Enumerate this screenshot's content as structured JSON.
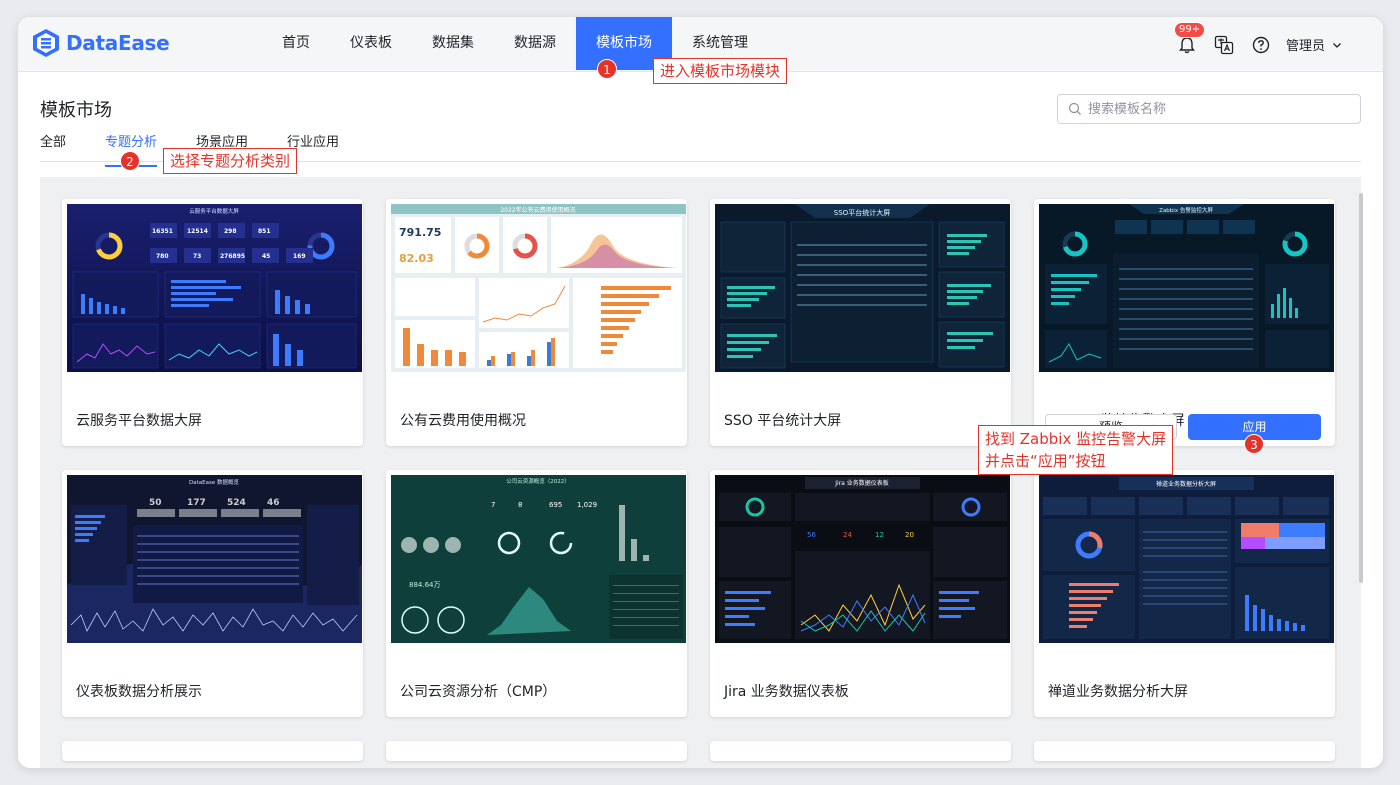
{
  "app": {
    "logo_text": "DataEase"
  },
  "nav": [
    {
      "label": "首页"
    },
    {
      "label": "仪表板"
    },
    {
      "label": "数据集"
    },
    {
      "label": "数据源"
    },
    {
      "label": "模板市场",
      "active": true
    },
    {
      "label": "系统管理"
    }
  ],
  "header": {
    "badge": "99+",
    "user": "管理员"
  },
  "page": {
    "title": "模板市场",
    "search_placeholder": "搜索模板名称"
  },
  "tabs": [
    {
      "label": "全部"
    },
    {
      "label": "专题分析",
      "active": true
    },
    {
      "label": "场景应用"
    },
    {
      "label": "行业应用"
    }
  ],
  "cards": [
    {
      "name": "云服务平台数据大屏",
      "thumb_title": "云服务平台数据大屏"
    },
    {
      "name": "公有云费用使用概况",
      "thumb_title": "2022年公有云费用使用概况"
    },
    {
      "name": "SSO 平台统计大屏",
      "thumb_title": "SSO平台统计大屏"
    },
    {
      "name": "Zabbix 监控告警大屏",
      "thumb_title": "Zabbix 告警监控大屏"
    },
    {
      "name": "仪表板数据分析展示",
      "thumb_title": "DataEase 数据概览"
    },
    {
      "name": "公司云资源分析（CMP）",
      "thumb_title": "公司云资源概览（2022）"
    },
    {
      "name": "Jira 业务数据仪表板",
      "thumb_title": "Jira 业务数据仪表板"
    },
    {
      "name": "禅道业务数据分析大屏",
      "thumb_title": "禅道业务数据分析大屏"
    }
  ],
  "thumb_numbers": {
    "c1": [
      "16351",
      "12514",
      "298",
      "851",
      "780",
      "73",
      "276895",
      "45",
      "169"
    ],
    "c2": [
      "791.75",
      "82.03"
    ],
    "c5": [
      "50",
      "177",
      "524",
      "46"
    ],
    "c6": [
      "7",
      "8",
      "695",
      "1,029",
      "884.64万"
    ],
    "c7": [
      "56",
      "24",
      "12",
      "20"
    ]
  },
  "card_actions": {
    "preview": "预览",
    "apply": "应用"
  },
  "annotations": {
    "a1": "进入模板市场模块",
    "a2": "选择专题分析类别",
    "a3_line1": "找到 Zabbix 监控告警大屏",
    "a3_line2": "并点击“应用”按钮",
    "n1": "1",
    "n2": "2",
    "n3": "3"
  },
  "colors": {
    "primary": "#3370ff",
    "annotation": "#e6332a"
  }
}
